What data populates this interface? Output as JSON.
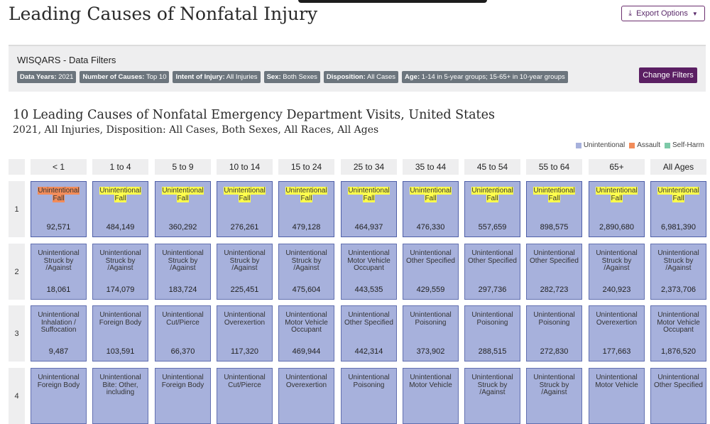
{
  "page": {
    "title": "Leading Causes of Nonfatal Injury",
    "export_label": "Export Options"
  },
  "filters": {
    "panel_title": "WISQARS - Data Filters",
    "chips": [
      {
        "key": "Data Years:",
        "value": "2021"
      },
      {
        "key": "Number of Causes:",
        "value": "Top 10"
      },
      {
        "key": "Intent of Injury:",
        "value": "All Injuries"
      },
      {
        "key": "Sex:",
        "value": "Both Sexes"
      },
      {
        "key": "Disposition:",
        "value": "All Cases"
      },
      {
        "key": "Age:",
        "value": "1-14 in 5-year groups; 15-65+ in 10-year groups"
      }
    ],
    "change_label": "Change Filters"
  },
  "chart": {
    "title": "10 Leading Causes of Nonfatal Emergency Department Visits, United States",
    "subtitle": "2021, All Injuries,  Disposition: All Cases, Both Sexes, All Races, All Ages",
    "legend": [
      {
        "label": "Unintentional",
        "color": "#a7b1dc"
      },
      {
        "label": "Assault",
        "color": "#f28c5a"
      },
      {
        "label": "Self-Harm",
        "color": "#7dc9a8"
      }
    ],
    "age_groups": [
      "< 1",
      "1 to 4",
      "5 to 9",
      "10 to 14",
      "15 to 24",
      "25 to 34",
      "35 to 44",
      "45 to 54",
      "55 to 64",
      "65+",
      "All Ages"
    ],
    "ranks": [
      {
        "label": "1",
        "cells": [
          {
            "intent": "Unintentional",
            "cause": "Fall",
            "count": "92,571",
            "hl": "orange"
          },
          {
            "intent": "Unintentional",
            "cause": "Fall",
            "count": "484,149",
            "hl": "yellow"
          },
          {
            "intent": "Unintentional",
            "cause": "Fall",
            "count": "360,292",
            "hl": "yellow"
          },
          {
            "intent": "Unintentional",
            "cause": "Fall",
            "count": "276,261",
            "hl": "yellow"
          },
          {
            "intent": "Unintentional",
            "cause": "Fall",
            "count": "479,128",
            "hl": "yellow"
          },
          {
            "intent": "Unintentional",
            "cause": "Fall",
            "count": "464,937",
            "hl": "yellow"
          },
          {
            "intent": "Unintentional",
            "cause": "Fall",
            "count": "476,330",
            "hl": "yellow"
          },
          {
            "intent": "Unintentional",
            "cause": "Fall",
            "count": "557,659",
            "hl": "yellow"
          },
          {
            "intent": "Unintentional",
            "cause": "Fall",
            "count": "898,575",
            "hl": "yellow"
          },
          {
            "intent": "Unintentional",
            "cause": "Fall",
            "count": "2,890,680",
            "hl": "yellow"
          },
          {
            "intent": "Unintentional",
            "cause": "Fall",
            "count": "6,981,390",
            "hl": "yellow"
          }
        ]
      },
      {
        "label": "2",
        "cells": [
          {
            "intent": "Unintentional",
            "cause": "Struck by /Against",
            "count": "18,061"
          },
          {
            "intent": "Unintentional",
            "cause": "Struck by /Against",
            "count": "174,079"
          },
          {
            "intent": "Unintentional",
            "cause": "Struck by /Against",
            "count": "183,724"
          },
          {
            "intent": "Unintentional",
            "cause": "Struck by /Against",
            "count": "225,451"
          },
          {
            "intent": "Unintentional",
            "cause": "Struck by /Against",
            "count": "475,604"
          },
          {
            "intent": "Unintentional",
            "cause": "Motor Vehicle Occupant",
            "count": "443,535"
          },
          {
            "intent": "Unintentional",
            "cause": "Other Specified",
            "count": "429,559"
          },
          {
            "intent": "Unintentional",
            "cause": "Other Specified",
            "count": "297,736"
          },
          {
            "intent": "Unintentional",
            "cause": "Other Specified",
            "count": "282,723"
          },
          {
            "intent": "Unintentional",
            "cause": "Struck by /Against",
            "count": "240,923"
          },
          {
            "intent": "Unintentional",
            "cause": "Struck by /Against",
            "count": "2,373,706"
          }
        ]
      },
      {
        "label": "3",
        "cells": [
          {
            "intent": "Unintentional",
            "cause": "Inhalation / Suffocation",
            "count": "9,487"
          },
          {
            "intent": "Unintentional",
            "cause": "Foreign Body",
            "count": "103,591"
          },
          {
            "intent": "Unintentional",
            "cause": "Cut/Pierce",
            "count": "66,370"
          },
          {
            "intent": "Unintentional",
            "cause": "Overexertion",
            "count": "117,320"
          },
          {
            "intent": "Unintentional",
            "cause": "Motor Vehicle Occupant",
            "count": "469,944"
          },
          {
            "intent": "Unintentional",
            "cause": "Other Specified",
            "count": "442,314"
          },
          {
            "intent": "Unintentional",
            "cause": "Poisoning",
            "count": "373,902"
          },
          {
            "intent": "Unintentional",
            "cause": "Poisoning",
            "count": "288,515"
          },
          {
            "intent": "Unintentional",
            "cause": "Poisoning",
            "count": "272,830"
          },
          {
            "intent": "Unintentional",
            "cause": "Overexertion",
            "count": "177,663"
          },
          {
            "intent": "Unintentional",
            "cause": "Motor Vehicle Occupant",
            "count": "1,876,520"
          }
        ]
      },
      {
        "label": "4",
        "cells": [
          {
            "intent": "Unintentional",
            "cause": "Foreign Body",
            "count": ""
          },
          {
            "intent": "Unintentional",
            "cause": "Bite: Other, including",
            "count": ""
          },
          {
            "intent": "Unintentional",
            "cause": "Foreign Body",
            "count": ""
          },
          {
            "intent": "Unintentional",
            "cause": "Cut/Pierce",
            "count": ""
          },
          {
            "intent": "Unintentional",
            "cause": "Overexertion",
            "count": ""
          },
          {
            "intent": "Unintentional",
            "cause": "Poisoning",
            "count": ""
          },
          {
            "intent": "Unintentional",
            "cause": "Motor Vehicle",
            "count": ""
          },
          {
            "intent": "Unintentional",
            "cause": "Struck by /Against",
            "count": ""
          },
          {
            "intent": "Unintentional",
            "cause": "Struck by /Against",
            "count": ""
          },
          {
            "intent": "Unintentional",
            "cause": "Motor Vehicle",
            "count": ""
          },
          {
            "intent": "Unintentional",
            "cause": "Other Specified",
            "count": ""
          }
        ]
      }
    ]
  }
}
